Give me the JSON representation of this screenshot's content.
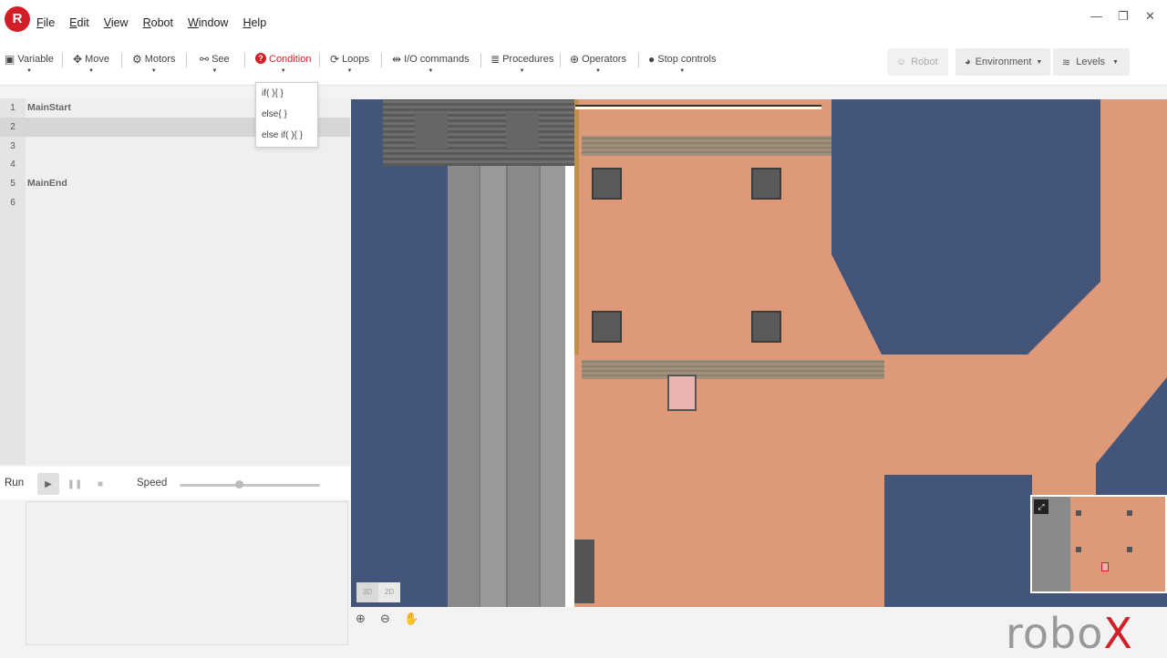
{
  "app": {
    "logo_letter": "R",
    "brand": "robo",
    "brand_x": "X"
  },
  "menu": [
    "File",
    "Edit",
    "View",
    "Robot",
    "Window",
    "Help"
  ],
  "window_controls": {
    "minimize": "—",
    "restore": "❐",
    "close": "✕"
  },
  "toolbar": {
    "items": [
      {
        "label": "Variable",
        "icon": "variable-icon",
        "glyph": "▣"
      },
      {
        "label": "Move",
        "icon": "move-icon",
        "glyph": "✥"
      },
      {
        "label": "Motors",
        "icon": "gear-icon",
        "glyph": "⚙"
      },
      {
        "label": "See",
        "icon": "binoculars-icon",
        "glyph": "⚯"
      },
      {
        "label": "Condition",
        "icon": "question-icon",
        "glyph": "?"
      },
      {
        "label": "Loops",
        "icon": "loop-icon",
        "glyph": "⟳"
      },
      {
        "label": "I/O commands",
        "icon": "io-icon",
        "glyph": "⇹"
      },
      {
        "label": "Procedures",
        "icon": "list-icon",
        "glyph": "≣"
      },
      {
        "label": "Operators",
        "icon": "plus-circle-icon",
        "glyph": "⊕"
      },
      {
        "label": "Stop controls",
        "icon": "stop-icon",
        "glyph": "●"
      }
    ],
    "active": "Condition",
    "right": {
      "robot": "Robot",
      "environment": "Environment",
      "levels": "Levels"
    }
  },
  "condition_dropdown": [
    "if(  ){   }",
    "else{   }",
    "else if(  ){   }"
  ],
  "editor": {
    "lines": [
      {
        "num": "1",
        "code": "MainStart"
      },
      {
        "num": "2",
        "code": ""
      },
      {
        "num": "3",
        "code": ""
      },
      {
        "num": "4",
        "code": ""
      },
      {
        "num": "5",
        "code": "MainEnd"
      },
      {
        "num": "6",
        "code": ""
      }
    ],
    "highlighted_line": 2
  },
  "run": {
    "label": "Run",
    "speed_label": "Speed",
    "speed_value": 0.42
  },
  "view": {
    "btn_3d": "3D",
    "btn_2d": "2D",
    "mode": "2D"
  },
  "colors": {
    "accent": "#d21f27",
    "floor": "#de9978",
    "void": "#44557a"
  }
}
